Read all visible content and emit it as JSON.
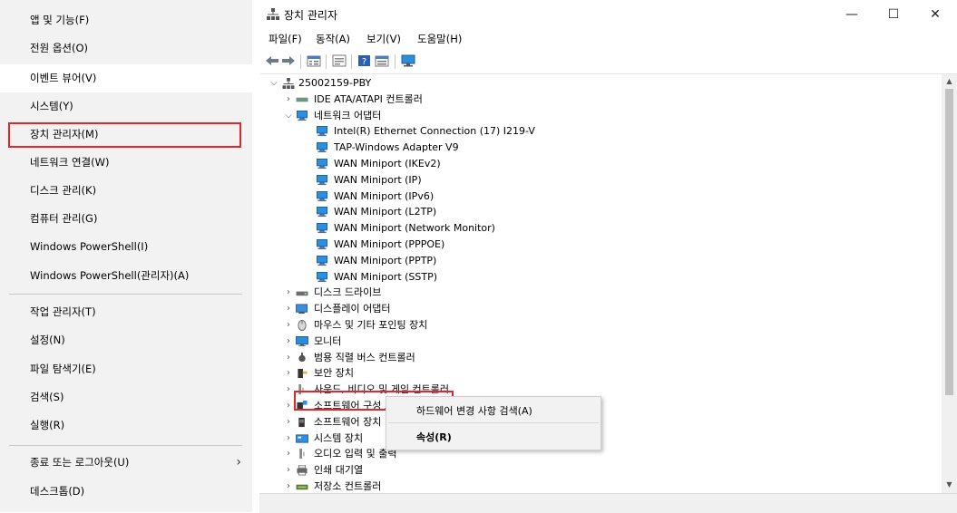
{
  "winx": {
    "items": [
      "앱 및 기능(F)",
      "전원 옵션(O)",
      "이벤트 뷰어(V)",
      "시스템(Y)",
      "장치 관리자(M)",
      "네트워크 연결(W)",
      "디스크 관리(K)",
      "컴퓨터 관리(G)",
      "Windows PowerShell(I)",
      "Windows PowerShell(관리자)(A)",
      "작업 관리자(T)",
      "설정(N)",
      "파일 탐색기(E)",
      "검색(S)",
      "실행(R)",
      "종료 또는 로그아웃(U)",
      "데스크톱(D)"
    ],
    "chevron": "›"
  },
  "window": {
    "title": "장치 관리자",
    "controls": {
      "minimize": "—",
      "maximize": "☐",
      "close": "✕"
    }
  },
  "menubar": [
    "파일(F)",
    "동작(A)",
    "보기(V)",
    "도움말(H)"
  ],
  "tree": {
    "root": "25002159-PBY",
    "rows": [
      {
        "label": "IDE ATA/ATAPI 컨트롤러",
        "level": 1,
        "twisty": ">",
        "icon": "ide-controller-icon"
      },
      {
        "label": "네트워크 어댑터",
        "level": 1,
        "twisty": "v",
        "icon": "network-adapter-icon"
      },
      {
        "label": "Intel(R) Ethernet Connection (17) I219-V",
        "level": 2,
        "twisty": "",
        "icon": "network-adapter-icon"
      },
      {
        "label": "TAP-Windows Adapter V9",
        "level": 2,
        "twisty": "",
        "icon": "network-adapter-icon"
      },
      {
        "label": "WAN Miniport (IKEv2)",
        "level": 2,
        "twisty": "",
        "icon": "network-adapter-icon"
      },
      {
        "label": "WAN Miniport (IP)",
        "level": 2,
        "twisty": "",
        "icon": "network-adapter-icon"
      },
      {
        "label": "WAN Miniport (IPv6)",
        "level": 2,
        "twisty": "",
        "icon": "network-adapter-icon"
      },
      {
        "label": "WAN Miniport (L2TP)",
        "level": 2,
        "twisty": "",
        "icon": "network-adapter-icon"
      },
      {
        "label": "WAN Miniport (Network Monitor)",
        "level": 2,
        "twisty": "",
        "icon": "network-adapter-icon"
      },
      {
        "label": "WAN Miniport (PPPOE)",
        "level": 2,
        "twisty": "",
        "icon": "network-adapter-icon"
      },
      {
        "label": "WAN Miniport (PPTP)",
        "level": 2,
        "twisty": "",
        "icon": "network-adapter-icon"
      },
      {
        "label": "WAN Miniport (SSTP)",
        "level": 2,
        "twisty": "",
        "icon": "network-adapter-icon"
      },
      {
        "label": "디스크 드라이브",
        "level": 1,
        "twisty": ">",
        "icon": "disk-drive-icon"
      },
      {
        "label": "디스플레이 어댑터",
        "level": 1,
        "twisty": ">",
        "icon": "display-adapter-icon"
      },
      {
        "label": "마우스 및 기타 포인팅 장치",
        "level": 1,
        "twisty": ">",
        "icon": "mouse-icon"
      },
      {
        "label": "모니터",
        "level": 1,
        "twisty": ">",
        "icon": "monitor-icon"
      },
      {
        "label": "범용 직렬 버스 컨트롤러",
        "level": 1,
        "twisty": ">",
        "icon": "usb-icon"
      },
      {
        "label": "보안 장치",
        "level": 1,
        "twisty": ">",
        "icon": "security-device-icon"
      },
      {
        "label": "사운드, 비디오 및 게임 컨트롤러",
        "level": 1,
        "twisty": ">",
        "icon": "sound-icon"
      },
      {
        "label": "소프트웨어 구성 요소",
        "level": 1,
        "twisty": ">",
        "icon": "software-component-icon"
      },
      {
        "label": "소프트웨어 장치",
        "level": 1,
        "twisty": ">",
        "icon": "software-device-icon"
      },
      {
        "label": "시스템 장치",
        "level": 1,
        "twisty": ">",
        "icon": "system-device-icon"
      },
      {
        "label": "오디오 입력 및 출력",
        "level": 1,
        "twisty": ">",
        "icon": "audio-icon"
      },
      {
        "label": "인쇄 대기열",
        "level": 1,
        "twisty": ">",
        "icon": "printer-icon"
      },
      {
        "label": "저장소 컨트롤러",
        "level": 1,
        "twisty": ">",
        "icon": "storage-controller-icon"
      }
    ]
  },
  "context_menu": {
    "items": [
      "하드웨어 변경 사항 검색(A)",
      "속성(R)"
    ]
  },
  "colors": {
    "highlight_red": "#e2262c",
    "network_icon": "#1e88e5"
  }
}
